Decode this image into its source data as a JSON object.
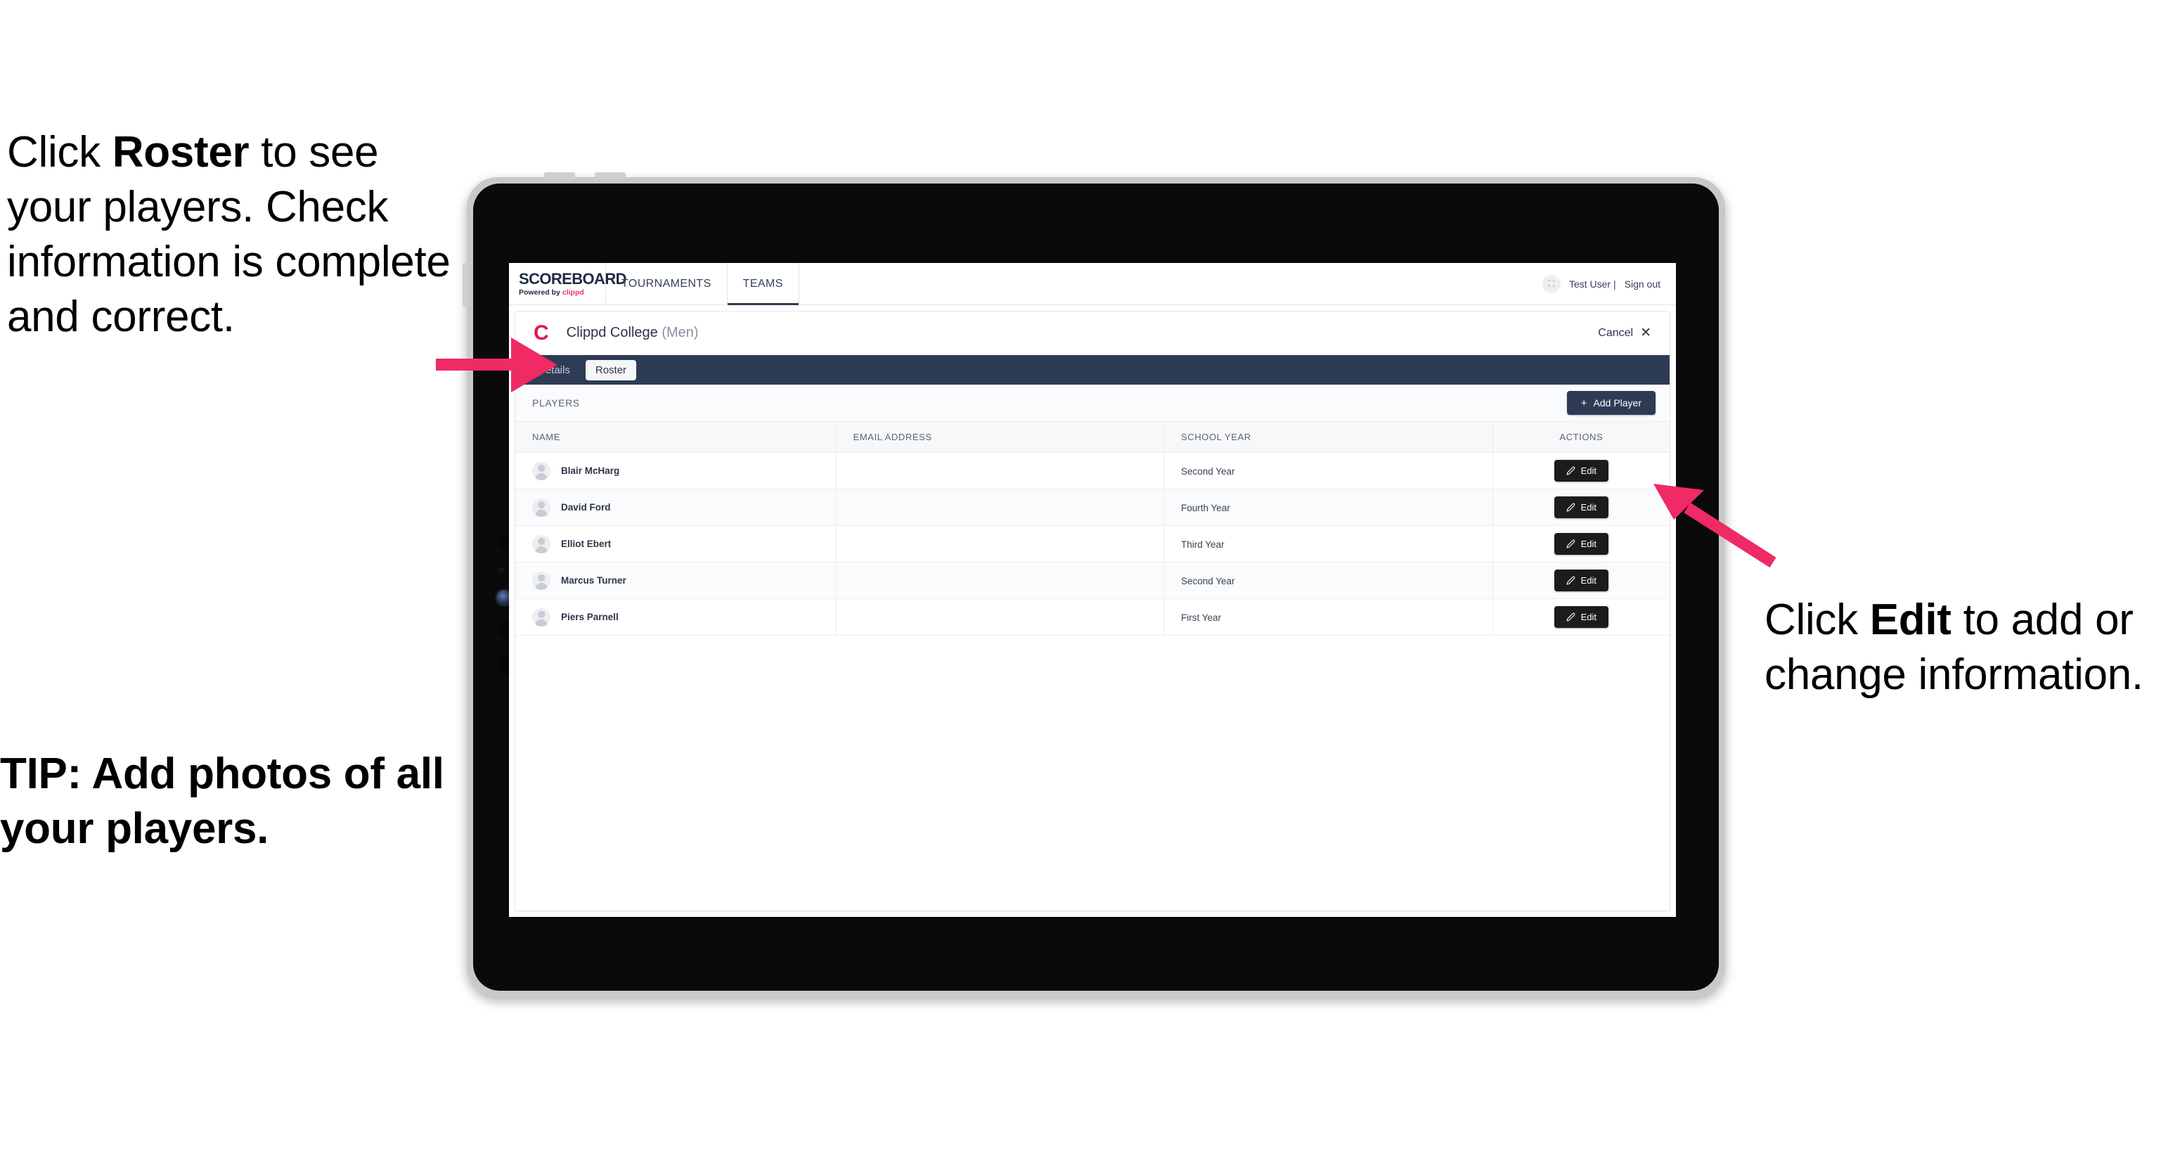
{
  "callouts": {
    "left_part1": "Click ",
    "left_bold": "Roster",
    "left_part2": " to see your players. Check information is complete and correct.",
    "tip": "TIP: Add photos of all your players.",
    "right_part1": "Click ",
    "right_bold": "Edit",
    "right_part2": " to add or change information."
  },
  "colors": {
    "accent_pink": "#f0306b",
    "brand_red": "#e8134b",
    "navy": "#2e3b55",
    "dark_button": "#1c1c1e"
  },
  "app": {
    "brand": {
      "name": "SCOREBOARD",
      "powered_prefix": "Powered by ",
      "powered_brand": "clippd"
    },
    "topnav": [
      {
        "label": "TOURNAMENTS",
        "active": false
      },
      {
        "label": "TEAMS",
        "active": true
      }
    ],
    "user": {
      "avatar_glyph": "⛶",
      "name": "Test User |",
      "sign_out": "Sign out"
    },
    "team": {
      "logo_letter": "C",
      "name": "Clippd College",
      "gender": "(Men)",
      "cancel_label": "Cancel",
      "cancel_icon": "✕"
    },
    "tabs": [
      {
        "label": "Details",
        "active": false
      },
      {
        "label": "Roster",
        "active": true
      }
    ],
    "players_section": {
      "label": "PLAYERS",
      "add_button_label": "Add Player",
      "add_button_plus": "+"
    },
    "table": {
      "columns": [
        "NAME",
        "EMAIL ADDRESS",
        "SCHOOL YEAR",
        "ACTIONS"
      ],
      "rows": [
        {
          "name": "Blair McHarg",
          "email": "",
          "school_year": "Second Year",
          "action": "Edit"
        },
        {
          "name": "David Ford",
          "email": "",
          "school_year": "Fourth Year",
          "action": "Edit"
        },
        {
          "name": "Elliot Ebert",
          "email": "",
          "school_year": "Third Year",
          "action": "Edit"
        },
        {
          "name": "Marcus Turner",
          "email": "",
          "school_year": "Second Year",
          "action": "Edit"
        },
        {
          "name": "Piers Parnell",
          "email": "",
          "school_year": "First Year",
          "action": "Edit"
        }
      ]
    }
  }
}
